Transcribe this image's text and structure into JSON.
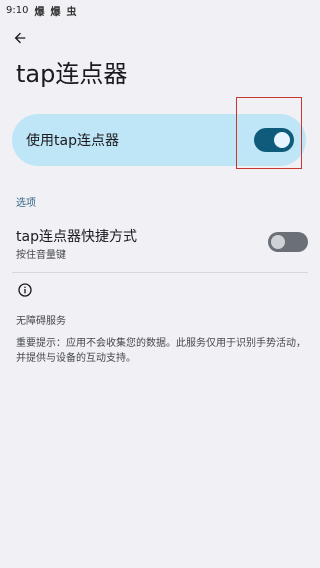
{
  "status_bar": {
    "time": "9:10",
    "icons": [
      "notification-icon",
      "notification-icon",
      "bug-icon"
    ]
  },
  "header": {
    "back_icon": "arrow-back-icon",
    "title": "tap连点器"
  },
  "main_toggle": {
    "label": "使用tap连点器",
    "enabled": true,
    "accent_color": "#0f5b7c",
    "card_color": "#bfe6f6"
  },
  "options": {
    "section_label": "选项",
    "shortcut": {
      "title": "tap连点器快捷方式",
      "subtitle": "按住音量键",
      "enabled": false
    }
  },
  "info": {
    "icon": "info-icon",
    "accessibility_label": "无障碍服务",
    "notice": "重要提示：应用不会收集您的数据。此服务仅用于识别手势活动，并提供与设备的互动支持。"
  }
}
